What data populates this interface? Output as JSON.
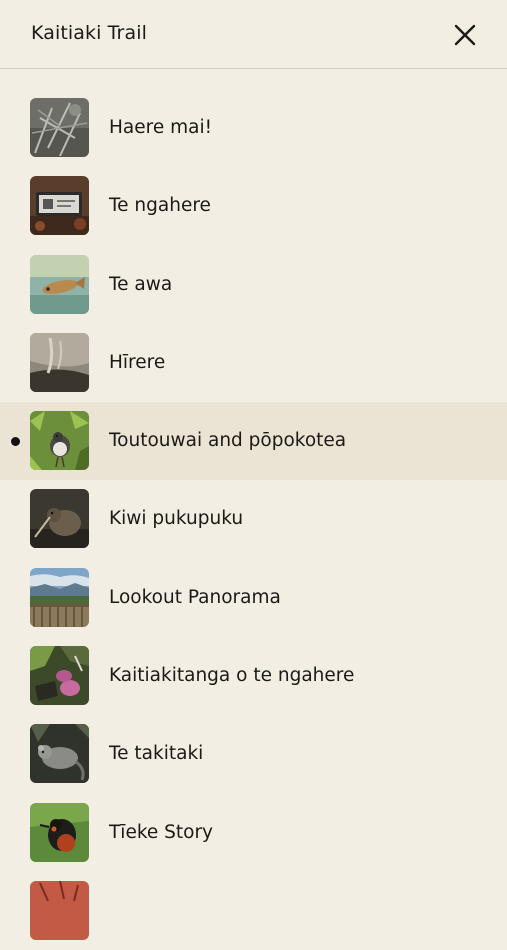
{
  "header": {
    "title": "Kaitiaki Trail",
    "close_icon": "close-icon"
  },
  "list": {
    "active_index": 4,
    "items": [
      {
        "label": "Haere mai!",
        "thumb": "forest-branches"
      },
      {
        "label": "Te ngahere",
        "thumb": "sign-board"
      },
      {
        "label": "Te awa",
        "thumb": "fish-in-water"
      },
      {
        "label": "Hīrere",
        "thumb": "waterfall-rock"
      },
      {
        "label": "Toutouwai and pōpokotea",
        "thumb": "robin-bird"
      },
      {
        "label": "Kiwi pukupuku",
        "thumb": "kiwi-bird"
      },
      {
        "label": "Lookout Panorama",
        "thumb": "lookout-view"
      },
      {
        "label": "Kaitiakitanga o te ngahere",
        "thumb": "hands-planting"
      },
      {
        "label": "Te takitaki",
        "thumb": "possum"
      },
      {
        "label": "Tīeke Story",
        "thumb": "tieke-bird"
      },
      {
        "label": "",
        "thumb": "red-partial"
      }
    ]
  },
  "colors": {
    "background": "#f3eee3",
    "active_row": "#ebe4d4",
    "divider": "#d6d0c4",
    "text": "#1c1a17"
  }
}
